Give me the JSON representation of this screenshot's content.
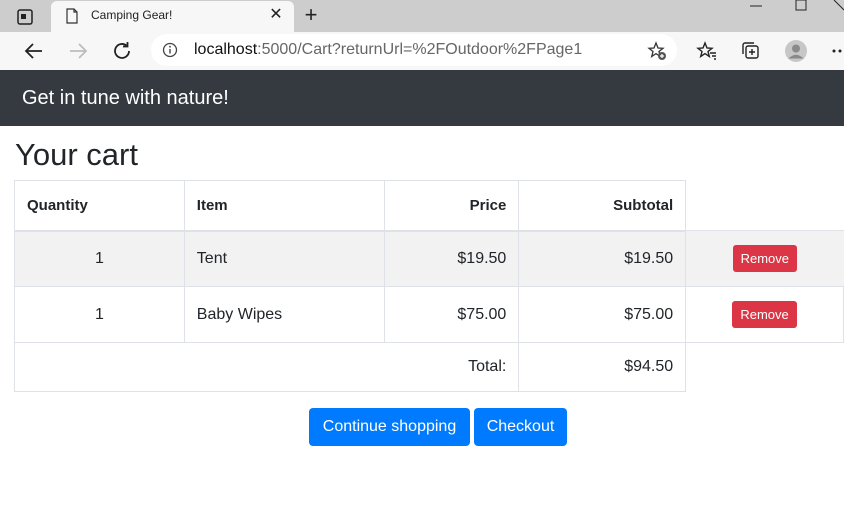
{
  "browser": {
    "tab_title": "Camping Gear!",
    "tab_close": "✕",
    "new_tab": "+",
    "url_host": "localhost",
    "url_rest": ":5000/Cart?returnUrl=%2FOutdoor%2FPage1"
  },
  "page": {
    "banner": "Get in tune with nature!",
    "heading": "Your cart",
    "table": {
      "headers": [
        "Quantity",
        "Item",
        "Price",
        "Subtotal"
      ],
      "rows": [
        {
          "quantity": "1",
          "item": "Tent",
          "price": "$19.50",
          "subtotal": "$19.50",
          "action": "Remove"
        },
        {
          "quantity": "1",
          "item": "Baby Wipes",
          "price": "$75.00",
          "subtotal": "$75.00",
          "action": "Remove"
        }
      ],
      "total_label": "Total:",
      "total_value": "$94.50"
    },
    "buttons": {
      "continue": "Continue shopping",
      "checkout": "Checkout"
    }
  },
  "colors": {
    "banner_bg": "#343a40",
    "primary": "#007bff",
    "danger": "#dc3545"
  }
}
